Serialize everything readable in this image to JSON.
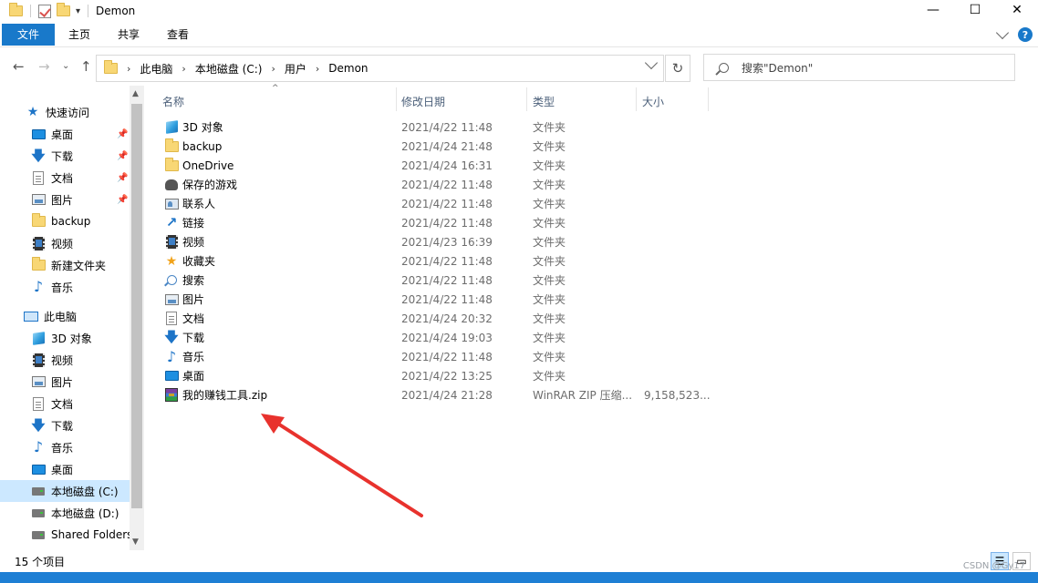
{
  "window": {
    "title": "Demon",
    "controls": {
      "minimize": "—",
      "maximize": "☐",
      "close": "✕"
    }
  },
  "ribbon": {
    "tabs": [
      "文件",
      "主页",
      "共享",
      "查看"
    ],
    "help": "?"
  },
  "address": {
    "crumbs": [
      "此电脑",
      "本地磁盘 (C:)",
      "用户",
      "Demon"
    ]
  },
  "search": {
    "placeholder": "搜索\"Demon\""
  },
  "sidebar": {
    "quick_access": "快速访问",
    "quick_items": [
      {
        "label": "桌面",
        "icon": "desktop-icon",
        "pinned": true
      },
      {
        "label": "下载",
        "icon": "download-icon",
        "pinned": true
      },
      {
        "label": "文档",
        "icon": "document-icon",
        "pinned": true
      },
      {
        "label": "图片",
        "icon": "picture-icon",
        "pinned": true
      },
      {
        "label": "backup",
        "icon": "folder-icon",
        "pinned": false
      },
      {
        "label": "视频",
        "icon": "video-icon",
        "pinned": false
      },
      {
        "label": "新建文件夹",
        "icon": "folder-icon",
        "pinned": false
      },
      {
        "label": "音乐",
        "icon": "music-icon",
        "pinned": false
      }
    ],
    "this_pc": "此电脑",
    "pc_items": [
      {
        "label": "3D 对象",
        "icon": "3d-objects-icon"
      },
      {
        "label": "视频",
        "icon": "video-icon"
      },
      {
        "label": "图片",
        "icon": "picture-icon"
      },
      {
        "label": "文档",
        "icon": "document-icon"
      },
      {
        "label": "下载",
        "icon": "download-icon"
      },
      {
        "label": "音乐",
        "icon": "music-icon"
      },
      {
        "label": "桌面",
        "icon": "desktop-icon"
      },
      {
        "label": "本地磁盘 (C:)",
        "icon": "drive-icon",
        "selected": true
      },
      {
        "label": "本地磁盘 (D:)",
        "icon": "drive-icon"
      },
      {
        "label": "Shared Folders",
        "icon": "drive-icon"
      }
    ]
  },
  "columns": {
    "name": "名称",
    "date": "修改日期",
    "type": "类型",
    "size": "大小"
  },
  "files": [
    {
      "name": "3D 对象",
      "date": "2021/4/22 11:48",
      "type": "文件夹",
      "size": "",
      "icon": "3d-objects-icon"
    },
    {
      "name": "backup",
      "date": "2021/4/24 21:48",
      "type": "文件夹",
      "size": "",
      "icon": "folder-icon"
    },
    {
      "name": "OneDrive",
      "date": "2021/4/24 16:31",
      "type": "文件夹",
      "size": "",
      "icon": "folder-icon"
    },
    {
      "name": "保存的游戏",
      "date": "2021/4/22 11:48",
      "type": "文件夹",
      "size": "",
      "icon": "saved-games-icon"
    },
    {
      "name": "联系人",
      "date": "2021/4/22 11:48",
      "type": "文件夹",
      "size": "",
      "icon": "contacts-icon"
    },
    {
      "name": "链接",
      "date": "2021/4/22 11:48",
      "type": "文件夹",
      "size": "",
      "icon": "links-icon"
    },
    {
      "name": "视频",
      "date": "2021/4/23 16:39",
      "type": "文件夹",
      "size": "",
      "icon": "video-icon"
    },
    {
      "name": "收藏夹",
      "date": "2021/4/22 11:48",
      "type": "文件夹",
      "size": "",
      "icon": "favorites-icon"
    },
    {
      "name": "搜索",
      "date": "2021/4/22 11:48",
      "type": "文件夹",
      "size": "",
      "icon": "searches-icon"
    },
    {
      "name": "图片",
      "date": "2021/4/22 11:48",
      "type": "文件夹",
      "size": "",
      "icon": "picture-icon"
    },
    {
      "name": "文档",
      "date": "2021/4/24 20:32",
      "type": "文件夹",
      "size": "",
      "icon": "document-icon"
    },
    {
      "name": "下载",
      "date": "2021/4/24 19:03",
      "type": "文件夹",
      "size": "",
      "icon": "download-icon"
    },
    {
      "name": "音乐",
      "date": "2021/4/22 11:48",
      "type": "文件夹",
      "size": "",
      "icon": "music-icon"
    },
    {
      "name": "桌面",
      "date": "2021/4/22 13:25",
      "type": "文件夹",
      "size": "",
      "icon": "desktop-icon"
    },
    {
      "name": "我的赚钱工具.zip",
      "date": "2021/4/24 21:28",
      "type": "WinRAR ZIP 压缩...",
      "size": "9,158,523...",
      "icon": "zip-archive-icon"
    }
  ],
  "status": {
    "count": "15 个项目"
  },
  "watermark": "CSDN @Gy17",
  "colors": {
    "accent": "#1979ca",
    "selection": "#cce8ff",
    "annotation_arrow": "#e8322d"
  }
}
